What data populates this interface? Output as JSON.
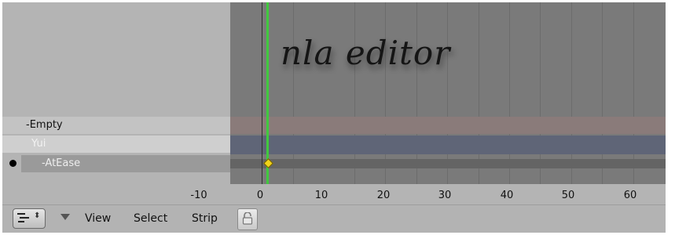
{
  "window": {
    "title": "nla editor"
  },
  "channels": [
    {
      "label": "-Empty"
    },
    {
      "label": "Yui"
    },
    {
      "label": "-AtEase"
    }
  ],
  "timeline": {
    "ticks": [
      "-10",
      "0",
      "10",
      "20",
      "30",
      "40",
      "50",
      "60"
    ],
    "playhead_frame": 1,
    "keyframe_frame": 1
  },
  "header": {
    "editor_type_icon": "nla-editor-icon",
    "menus": [
      "View",
      "Select",
      "Strip"
    ],
    "lock_icon": "lock-icon"
  },
  "colors": {
    "playhead": "#41c83e",
    "keyframe": "#f0d21a",
    "empty_track": "#8a7b7a",
    "object_track": "#5f6577"
  }
}
